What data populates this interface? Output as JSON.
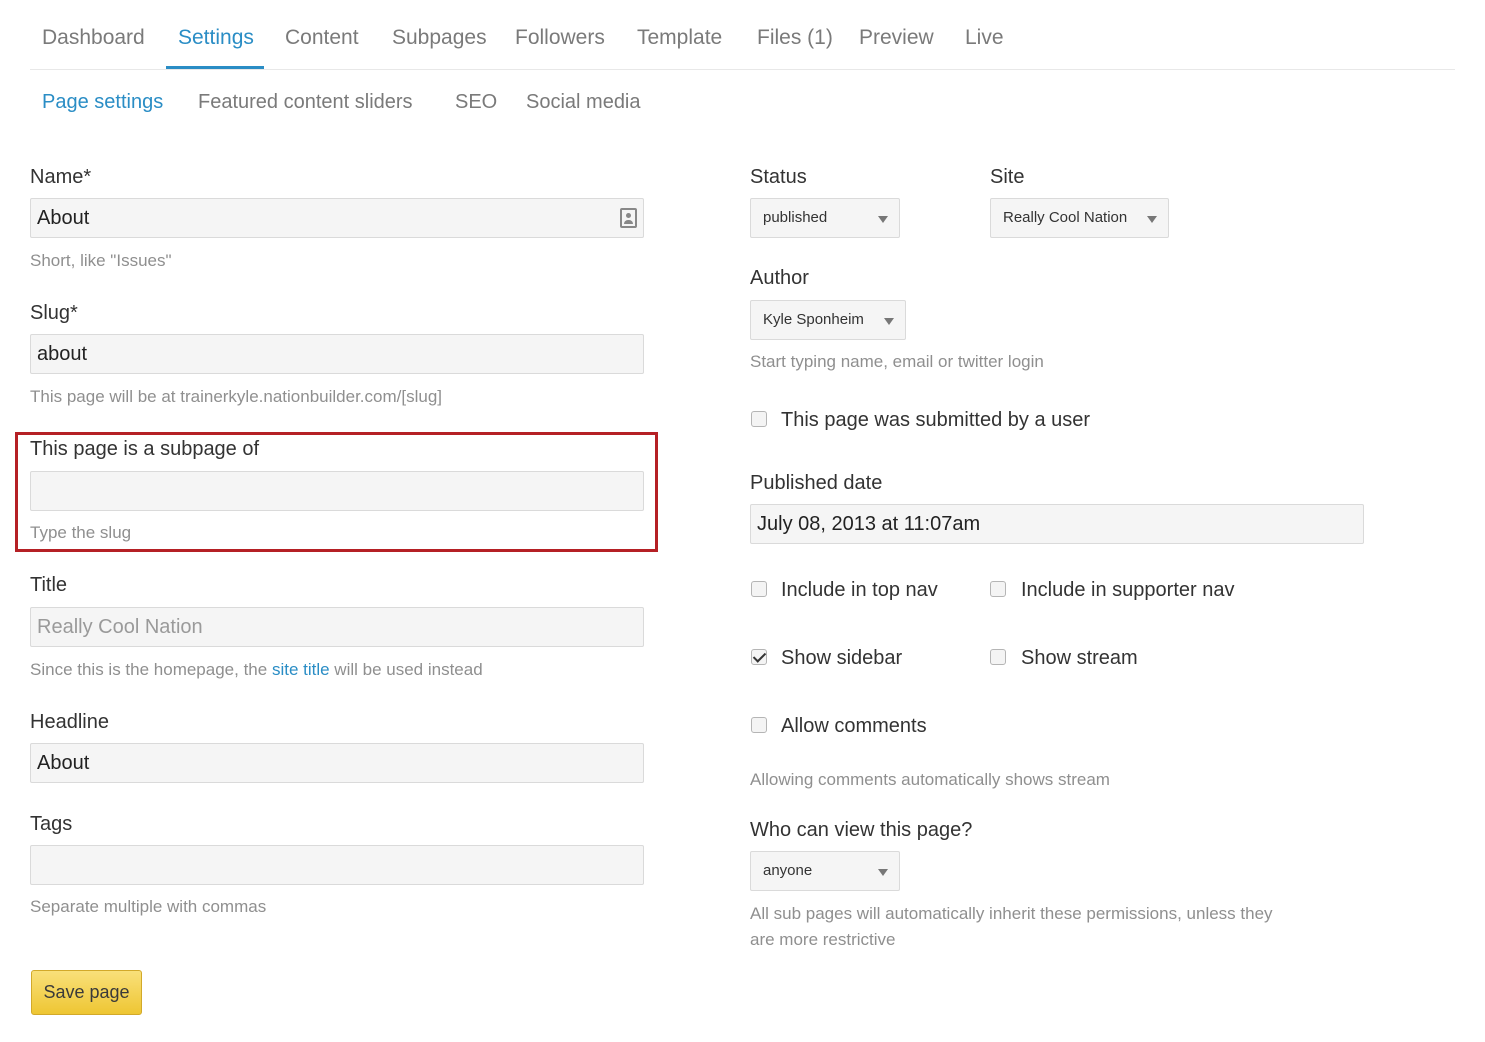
{
  "tabs": [
    {
      "label": "Dashboard"
    },
    {
      "label": "Settings"
    },
    {
      "label": "Content"
    },
    {
      "label": "Subpages"
    },
    {
      "label": "Followers"
    },
    {
      "label": "Template"
    },
    {
      "label": "Files (1)"
    },
    {
      "label": "Preview"
    },
    {
      "label": "Live"
    }
  ],
  "active_tab": "Settings",
  "subtabs": [
    {
      "label": "Page settings"
    },
    {
      "label": "Featured content sliders"
    },
    {
      "label": "SEO"
    },
    {
      "label": "Social media"
    }
  ],
  "active_subtab": "Page settings",
  "left": {
    "name": {
      "label": "Name*",
      "value": "About",
      "help": "Short, like \"Issues\""
    },
    "slug": {
      "label": "Slug*",
      "value": "about",
      "help": "This page will be at trainerkyle.nationbuilder.com/[slug]"
    },
    "subpage": {
      "label": "This page is a subpage of",
      "value": "",
      "help": "Type the slug"
    },
    "title": {
      "label": "Title",
      "value": "Really Cool Nation",
      "help_pre": "Since this is the homepage, the ",
      "help_link": "site title",
      "help_post": " will be used instead"
    },
    "headline": {
      "label": "Headline",
      "value": "About"
    },
    "tags": {
      "label": "Tags",
      "value": "",
      "help": "Separate multiple with commas"
    }
  },
  "right": {
    "status": {
      "label": "Status",
      "value": "published"
    },
    "site": {
      "label": "Site",
      "value": "Really Cool Nation"
    },
    "author": {
      "label": "Author",
      "value": "Kyle Sponheim",
      "help": "Start typing name, email or twitter login"
    },
    "submitted_by_user": {
      "label": "This page was submitted by a user",
      "checked": false
    },
    "published_date": {
      "label": "Published date",
      "value": "July 08, 2013 at 11:07am"
    },
    "include_top_nav": {
      "label": "Include in top nav",
      "checked": false
    },
    "include_supporter_nav": {
      "label": "Include in supporter nav",
      "checked": false
    },
    "show_sidebar": {
      "label": "Show sidebar",
      "checked": true
    },
    "show_stream": {
      "label": "Show stream",
      "checked": false
    },
    "allow_comments": {
      "label": "Allow comments",
      "checked": false,
      "help": "Allowing comments automatically shows stream"
    },
    "who_can_view": {
      "label": "Who can view this page?",
      "value": "anyone",
      "help_line1": "All sub pages will automatically inherit these permissions, unless they",
      "help_line2": "are more restrictive"
    }
  },
  "save_button": "Save page",
  "colors": {
    "accent": "#2a8dc5",
    "highlight": "#b52025",
    "button": "#eec633"
  }
}
